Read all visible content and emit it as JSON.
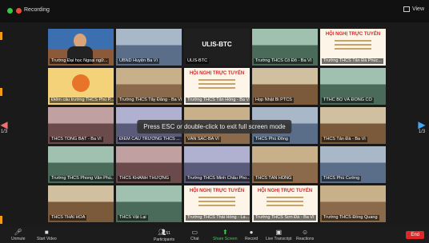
{
  "topbar": {
    "recording_label": "Recording",
    "view_label": "View"
  },
  "grid": {
    "tiles": [
      {
        "name": "Trường Đại học Ngoại ngữ...",
        "kind": "person",
        "active": true
      },
      {
        "name": "UBND Huyện Ba Vì",
        "kind": "room"
      },
      {
        "name": "ULIS-BTC",
        "kind": "text",
        "big": "ULIS-BTC"
      },
      {
        "name": "Trường THCS Cổ Đô - Ba Vì",
        "kind": "room"
      },
      {
        "name": "Trường THCS Tản Đà Phúc...",
        "kind": "banner",
        "banner_title": "HỘI NGHỊ TRỰC TUYẾN"
      },
      {
        "name": "Điểm cầu trường THCS Phú P...",
        "kind": "logo"
      },
      {
        "name": "Trường THCS Tây Đằng - Ba Vì",
        "kind": "room"
      },
      {
        "name": "Trường THCS Tản Hồng - Ba Vì",
        "kind": "banner",
        "banner_title": "HỘI NGHỊ TRỰC TUYẾN"
      },
      {
        "name": "Họp Nhật Bi PTCS",
        "kind": "room"
      },
      {
        "name": "TTHC BỘ VÀ ĐỒNG CỔ",
        "kind": "room"
      },
      {
        "name": "THCS TÒNG BẠT - Ba Vì",
        "kind": "room"
      },
      {
        "name": "ĐIỂM CẦU TRƯỜNG THCS ...",
        "kind": "room"
      },
      {
        "name": "VÂN SẢC-BA VÌ",
        "kind": "room"
      },
      {
        "name": "THCS Phú Đông",
        "kind": "room"
      },
      {
        "name": "THCS Tản Đà - Ba Vì",
        "kind": "room"
      },
      {
        "name": "Trường THCS Phong Vân Phú...",
        "kind": "room"
      },
      {
        "name": "THCS KHÁNH THƯỢNG",
        "kind": "room"
      },
      {
        "name": "Trường THCS Minh Châu Pho...",
        "kind": "room"
      },
      {
        "name": "THCS TẢN HỒNG",
        "kind": "room"
      },
      {
        "name": "THCS Phú Cường",
        "kind": "room"
      },
      {
        "name": "THCS THÁI HÒA",
        "kind": "room"
      },
      {
        "name": "THCS Vật Lại",
        "kind": "room"
      },
      {
        "name": "Trường THCS Thái Hồng - La...",
        "kind": "banner",
        "banner_title": "HỘI NGHỊ TRỰC TUYẾN"
      },
      {
        "name": "Trường THCS Sơn Đà - Ba Vì",
        "kind": "banner",
        "banner_title": "HỘI NGHỊ TRỰC TUYẾN"
      },
      {
        "name": "Trường THCS Đồng Quang",
        "kind": "room"
      }
    ]
  },
  "overlay": {
    "esc_message": "Press ESC or double-click to exit full screen mode"
  },
  "nav": {
    "left_page": "1/3",
    "right_page": "1/3"
  },
  "toolbar": {
    "unmute": "Unmute",
    "start_video": "Start Video",
    "participants": "Participants",
    "participants_count": "51",
    "chat": "Chat",
    "share_screen": "Share Screen",
    "record": "Record",
    "live_transcript": "Live Transcript",
    "reactions": "Reactions",
    "end": "End"
  },
  "colors": {
    "active_speaker": "#f1d20d",
    "share_green": "#3ccf4e",
    "end_red": "#e02727"
  }
}
